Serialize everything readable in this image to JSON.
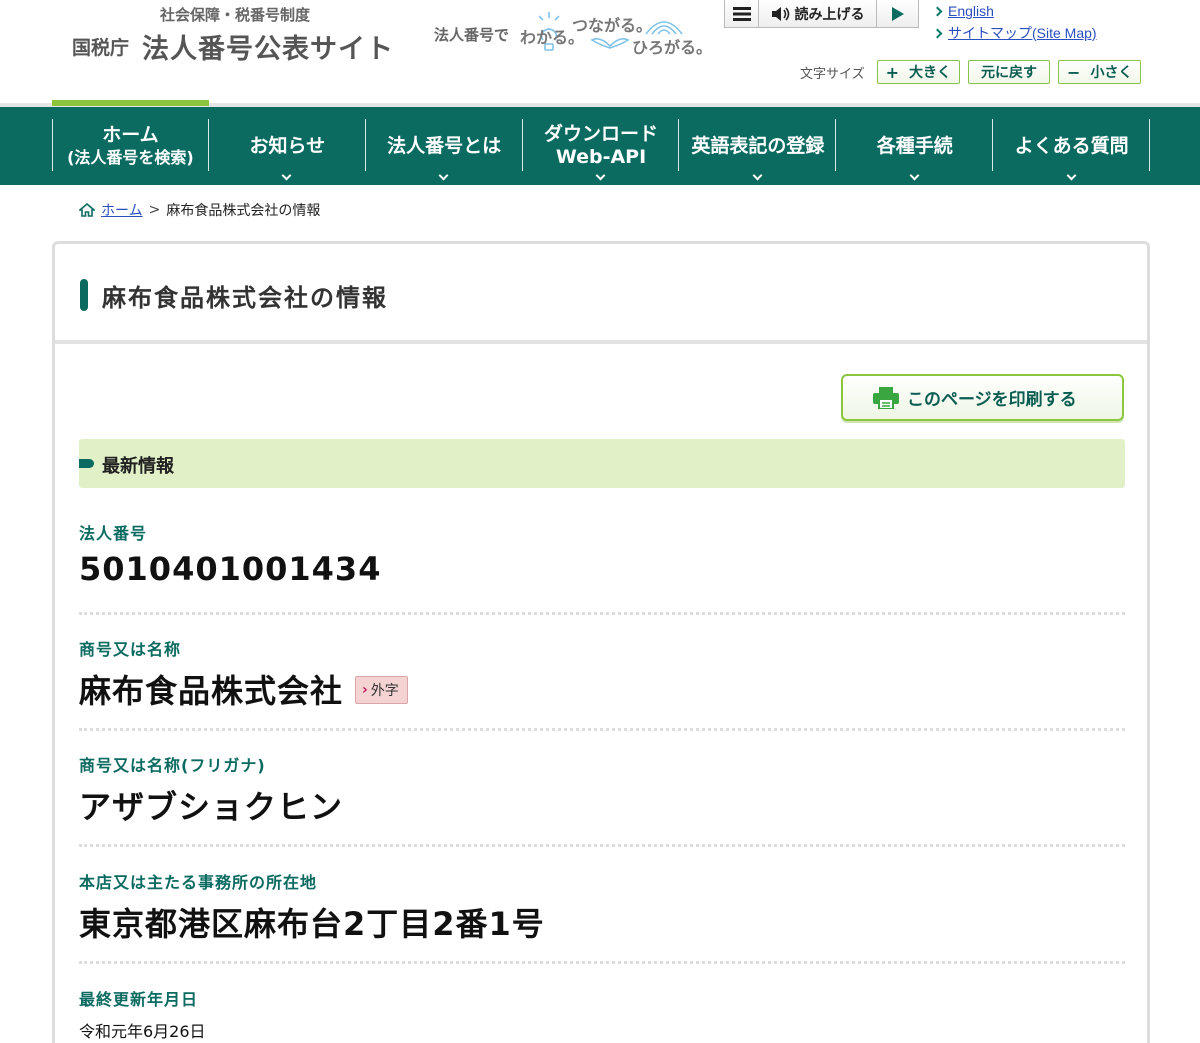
{
  "logo": {
    "subtitle": "社会保障・税番号制度",
    "agency": "国税庁",
    "title": "法人番号公表サイト"
  },
  "tagline": {
    "part1": "法人番号で",
    "part2": "わかる。",
    "part3": "つながる。",
    "part4": "ひろがる。"
  },
  "reader": {
    "menu_icon": "hamburger-icon",
    "read_label": "読み上げる",
    "speaker_icon": "speaker-icon",
    "play_icon": "play-icon"
  },
  "top_links": {
    "english": "English",
    "sitemap": "サイトマップ(Site Map)"
  },
  "font_size": {
    "label": "文字サイズ",
    "larger_symbol": "+",
    "larger": "大きく",
    "reset": "元に戻す",
    "smaller_symbol": "−",
    "smaller": "小さく"
  },
  "nav": {
    "items": [
      {
        "line1": "ホーム",
        "line2": "(法人番号を検索)"
      },
      {
        "line1": "お知らせ",
        "line2": ""
      },
      {
        "line1": "法人番号とは",
        "line2": ""
      },
      {
        "line1": "ダウンロード",
        "line2": "Web-API"
      },
      {
        "line1": "英語表記の登録",
        "line2": ""
      },
      {
        "line1": "各種手続",
        "line2": ""
      },
      {
        "line1": "よくある質問",
        "line2": ""
      }
    ],
    "accent_color": "#0b6b61",
    "active_color": "#8cc63f"
  },
  "breadcrumb": {
    "home_icon": "home-icon",
    "home": "ホーム",
    "separator": ">",
    "current": "麻布食品株式会社の情報"
  },
  "page": {
    "title": "麻布食品株式会社の情報",
    "print_label": "このページを印刷する",
    "print_icon": "printer-icon",
    "section_title": "最新情報"
  },
  "fields": {
    "number_label": "法人番号",
    "number_value": "5010401001434",
    "name_label": "商号又は名称",
    "name_value": "麻布食品株式会社",
    "gaiji_label": "外字",
    "kana_label": "商号又は名称(フリガナ)",
    "kana_value": "アザブショクヒン",
    "address_label": "本店又は主たる事務所の所在地",
    "address_value": "東京都港区麻布台2丁目2番1号",
    "updated_label": "最終更新年月日",
    "updated_value": "令和元年6月26日"
  }
}
